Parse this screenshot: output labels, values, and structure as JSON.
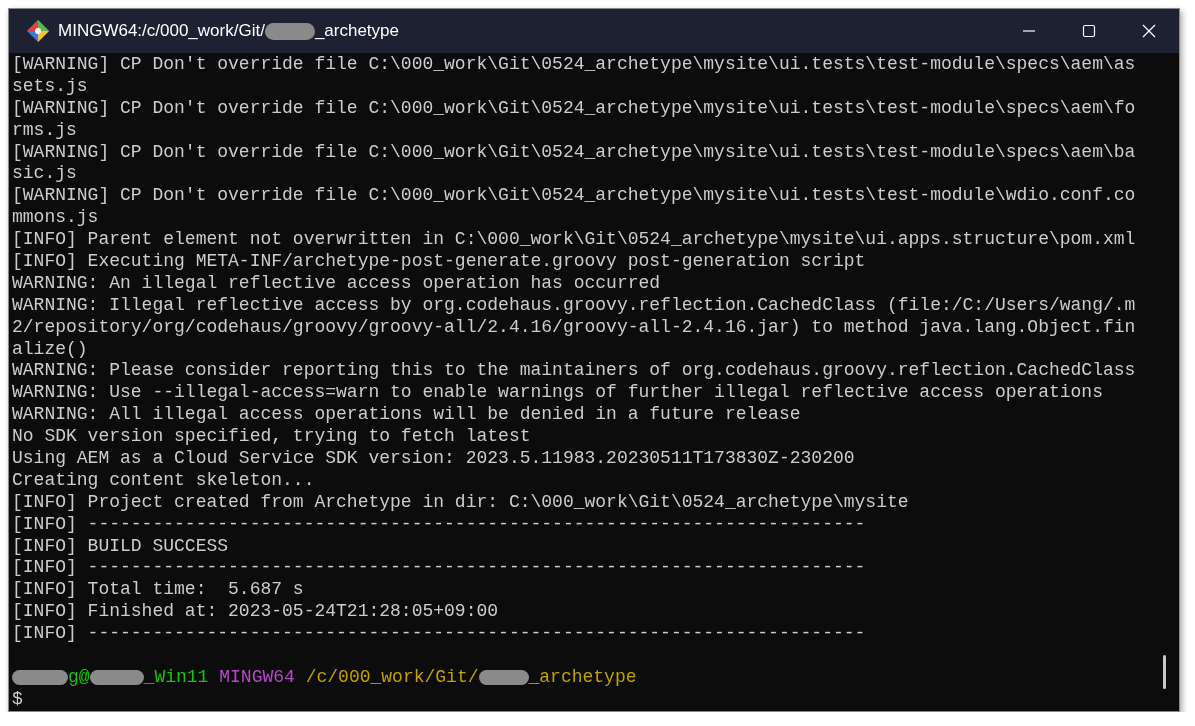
{
  "window": {
    "title_prefix": "MINGW64:/c/000_work/Git/",
    "title_suffix": "_archetype",
    "buttons": [
      {
        "kind": "minimize"
      },
      {
        "kind": "maximize"
      },
      {
        "kind": "close"
      }
    ]
  },
  "output": [
    "[WARNING] CP Don't override file C:\\000_work\\Git\\0524_archetype\\mysite\\ui.tests\\test-module\\specs\\aem\\as",
    "sets.js",
    "[WARNING] CP Don't override file C:\\000_work\\Git\\0524_archetype\\mysite\\ui.tests\\test-module\\specs\\aem\\fo",
    "rms.js",
    "[WARNING] CP Don't override file C:\\000_work\\Git\\0524_archetype\\mysite\\ui.tests\\test-module\\specs\\aem\\ba",
    "sic.js",
    "[WARNING] CP Don't override file C:\\000_work\\Git\\0524_archetype\\mysite\\ui.tests\\test-module\\wdio.conf.co",
    "mmons.js",
    "[INFO] Parent element not overwritten in C:\\000_work\\Git\\0524_archetype\\mysite\\ui.apps.structure\\pom.xml",
    "[INFO] Executing META-INF/archetype-post-generate.groovy post-generation script",
    "WARNING: An illegal reflective access operation has occurred",
    "WARNING: Illegal reflective access by org.codehaus.groovy.reflection.CachedClass (file:/C:/Users/wang/.m",
    "2/repository/org/codehaus/groovy/groovy-all/2.4.16/groovy-all-2.4.16.jar) to method java.lang.Object.fin",
    "alize()",
    "WARNING: Please consider reporting this to the maintainers of org.codehaus.groovy.reflection.CachedClass",
    "WARNING: Use --illegal-access=warn to enable warnings of further illegal reflective access operations",
    "WARNING: All illegal access operations will be denied in a future release",
    "No SDK version specified, trying to fetch latest",
    "Using AEM as a Cloud Service SDK version: 2023.5.11983.20230511T173830Z-230200",
    "Creating content skeleton...",
    "[INFO] Project created from Archetype in dir: C:\\000_work\\Git\\0524_archetype\\mysite",
    "[INFO] ------------------------------------------------------------------------",
    "[INFO] BUILD SUCCESS",
    "[INFO] ------------------------------------------------------------------------",
    "[INFO] Total time:  5.687 s",
    "[INFO] Finished at: 2023-05-24T21:28:05+09:00",
    "[INFO] ------------------------------------------------------------------------"
  ],
  "prompt": {
    "user_suffix": "g@",
    "host": "_Win11",
    "system": "MINGW64",
    "path_prefix": "/c/000_work/Git/",
    "path_suffix": "_archetype"
  },
  "input_line": "$"
}
